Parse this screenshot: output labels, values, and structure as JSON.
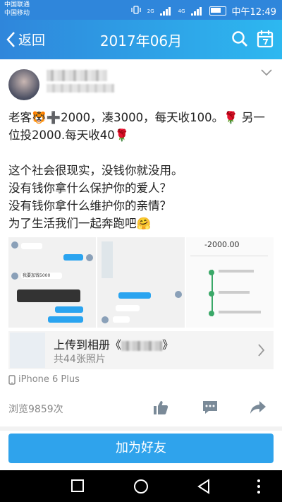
{
  "status": {
    "carrier1": "中国联通",
    "carrier2": "中国移动",
    "net1": "2G",
    "net2": "4G",
    "time": "中午12:49"
  },
  "header": {
    "back_label": "返回",
    "title": "2017年06月"
  },
  "post": {
    "lines": [
      "老客🐯➕2000，凑3000，每天收100。🌹 另一位投2000.每天收40🌹",
      "这个社会很现实，没钱你就没用。",
      "没有钱你拿什么保护你的爱人？",
      "没有钱你拿什么维护你的亲情？",
      "为了生活我们一起奔跑吧🤗"
    ],
    "photo1_amount": "5000",
    "photo3_amount": "-2000.00",
    "album_prefix": "上传到相册《",
    "album_suffix": "》",
    "album_count": "共44张照片",
    "device": "iPhone 6 Plus",
    "views": "浏览9859次"
  },
  "actions": {
    "add_friend": "加为好友"
  },
  "colors": {
    "accent": "#2fa3ec",
    "header_start": "#2f86db",
    "header_end": "#2db8f0"
  }
}
